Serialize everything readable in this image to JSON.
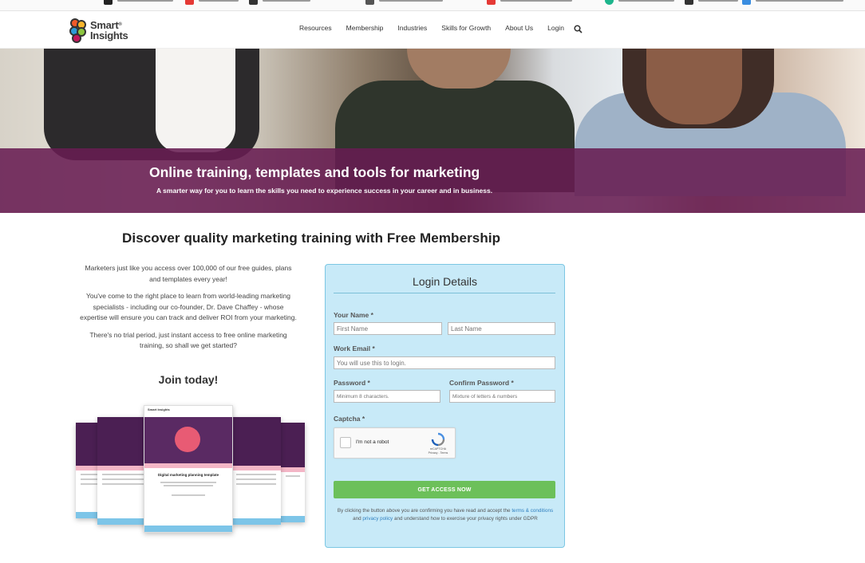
{
  "bookmark_bar": {
    "colors": [
      "#222222",
      "#e53935",
      "#333333",
      "#555555",
      "#e53935",
      "#1db58c",
      "#333333",
      "#3a8de0"
    ]
  },
  "header": {
    "logo_line1": "Smart",
    "logo_line2": "Insights",
    "logo_reg": "®",
    "nav": [
      "Resources",
      "Membership",
      "Industries",
      "Skills for Growth",
      "About Us",
      "Login"
    ],
    "search_icon": "search-icon"
  },
  "hero": {
    "title": "Online training, templates and tools for marketing",
    "subtitle": "A smarter way for you to learn the skills you need to experience success in your career and in business.",
    "band_color": "#6a1c52"
  },
  "main": {
    "title": "Discover quality marketing training with Free Membership",
    "paragraphs": [
      "Marketers just like you access over 100,000 of our free guides, plans and templates every year!",
      "You've come to the right place to learn from world-leading marketing specialists - including our co-founder, Dr. Dave Chaffey - whose expertise will ensure you can track and deliver ROI from your marketing.",
      "There's no trial period, just instant access to free online marketing training, so shall we get started?"
    ],
    "join": "Join today!",
    "mockup": {
      "logo": "Smart Insights",
      "title": "Digital marketing planning template"
    }
  },
  "form": {
    "title": "Login Details",
    "name_label": "Your Name *",
    "first_placeholder": "First Name",
    "last_placeholder": "Last Name",
    "email_label": "Work Email *",
    "email_placeholder": "You will use this to login.",
    "password_label": "Password *",
    "password_placeholder": "Minimum 8 characters.",
    "confirm_label": "Confirm Password *",
    "confirm_placeholder": "Mixture of letters & numbers",
    "captcha_label": "Captcha *",
    "captcha_text": "I'm not a robot",
    "captcha_brand": "reCAPTCHA",
    "captcha_links": "Privacy - Terms",
    "submit": "GET ACCESS NOW",
    "disclaimer_1": "By clicking the button above you are confirming you have read and accept the",
    "terms_link": "terms & conditions",
    "disclaimer_2": "and",
    "privacy_link": "privacy policy",
    "disclaimer_3": "and understand how to exercise your privacy rights under GDPR",
    "card_color": "#c8eaf8",
    "button_color": "#6cc05a"
  }
}
